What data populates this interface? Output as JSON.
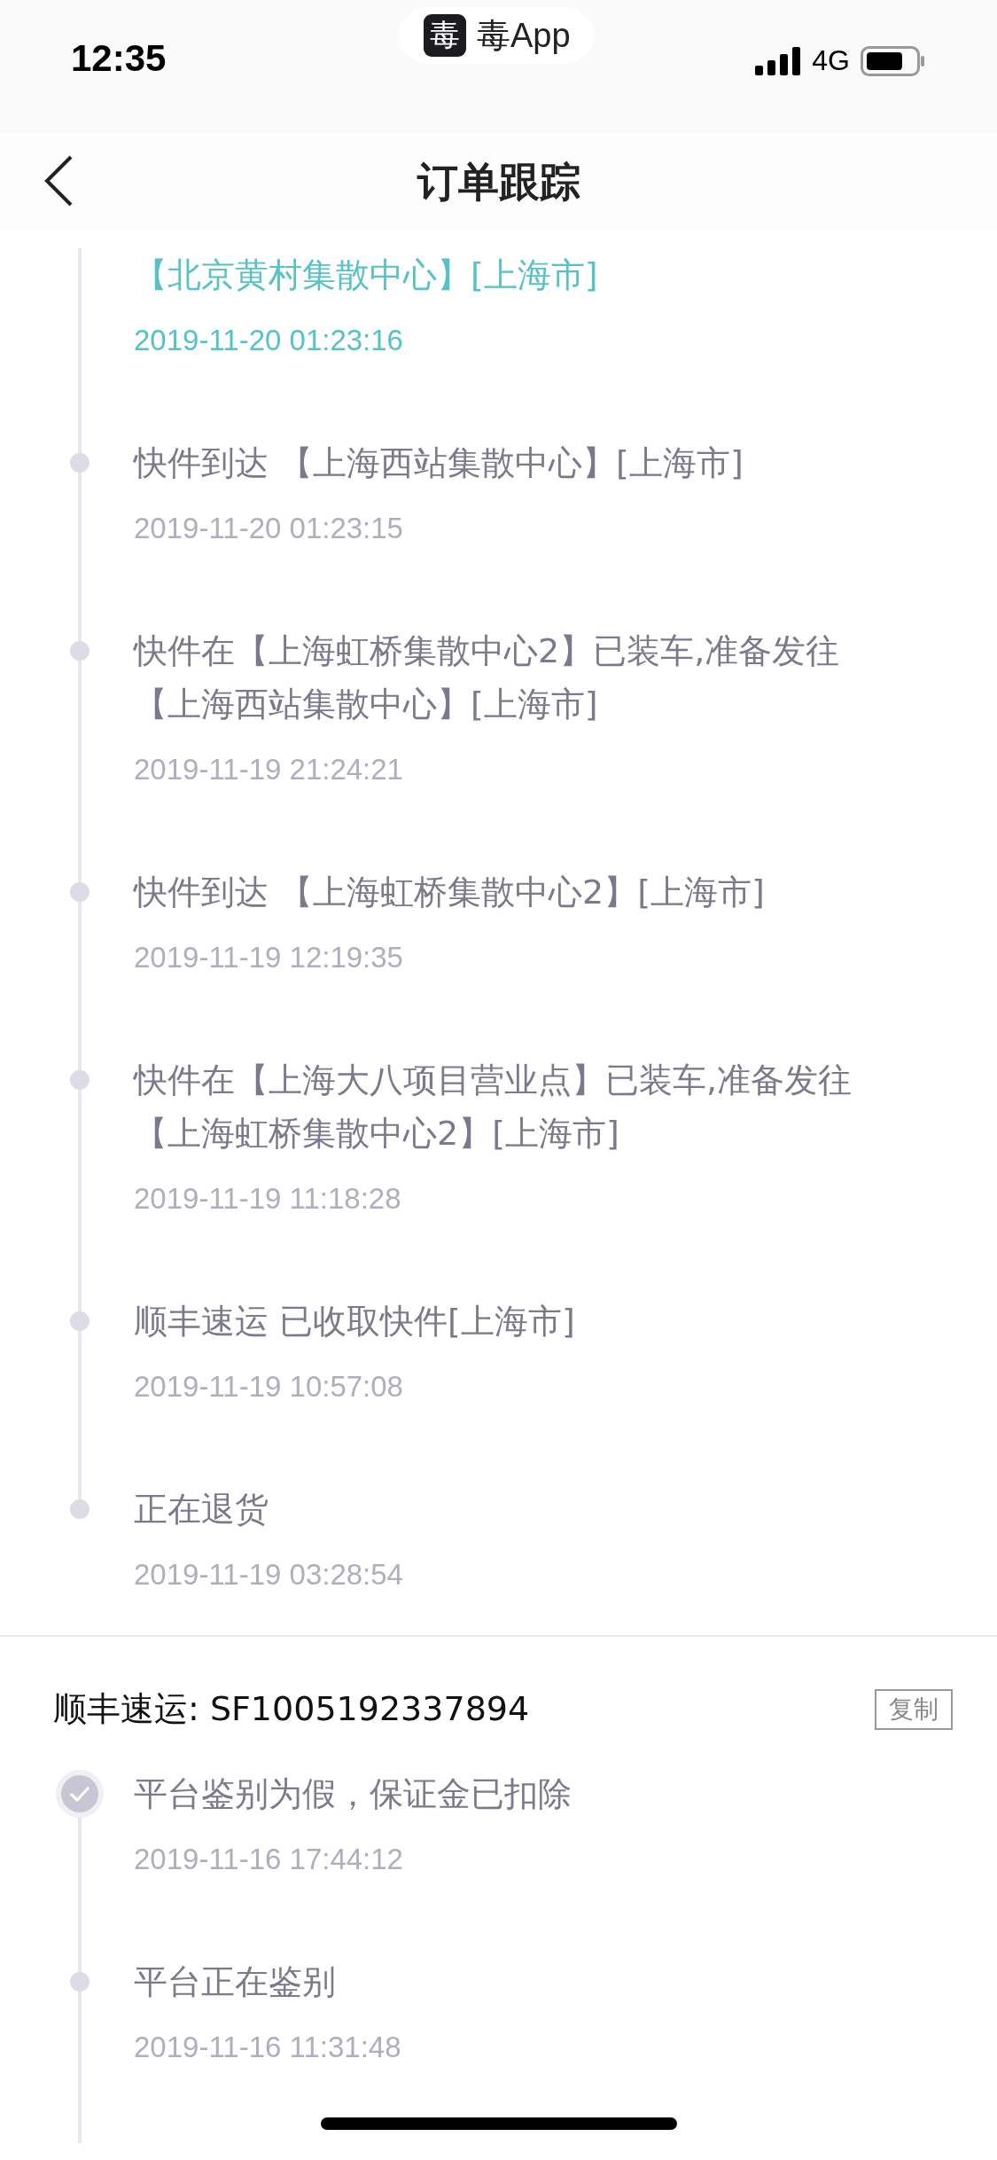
{
  "status_bar": {
    "time": "12:35",
    "app_badge": {
      "icon_char": "毒",
      "label": "毒App"
    },
    "network": "4G"
  },
  "nav": {
    "title": "订单跟踪"
  },
  "tracking": [
    {
      "lines": [
        "【北京黄村集散中心】[上海市]"
      ],
      "time": "2019-11-20 01:23:16",
      "current": true,
      "kind": "plain"
    },
    {
      "lines": [
        "快件到达 【上海西站集散中心】[上海市]"
      ],
      "time": "2019-11-20 01:23:15",
      "current": false,
      "kind": "dot"
    },
    {
      "lines": [
        "快件在【上海虹桥集散中心2】已装车,准备发往",
        "【上海西站集散中心】[上海市]"
      ],
      "time": "2019-11-19 21:24:21",
      "current": false,
      "kind": "dot"
    },
    {
      "lines": [
        "快件到达 【上海虹桥集散中心2】[上海市]"
      ],
      "time": "2019-11-19 12:19:35",
      "current": false,
      "kind": "dot"
    },
    {
      "lines": [
        "快件在【上海大八项目营业点】已装车,准备发往",
        "【上海虹桥集散中心2】[上海市]"
      ],
      "time": "2019-11-19 11:18:28",
      "current": false,
      "kind": "dot"
    },
    {
      "lines": [
        "顺丰速运 已收取快件[上海市]"
      ],
      "time": "2019-11-19 10:57:08",
      "current": false,
      "kind": "dot"
    },
    {
      "lines": [
        "正在退货"
      ],
      "time": "2019-11-19 03:28:54",
      "current": false,
      "kind": "dot"
    }
  ],
  "shipment": {
    "carrier_number": "顺丰速运: SF1005192337894",
    "copy_button": "复制",
    "events": [
      {
        "lines": [
          "平台鉴别为假，保证金已扣除"
        ],
        "time": "2019-11-16 17:44:12",
        "current": false,
        "kind": "check"
      },
      {
        "lines": [
          "平台正在鉴别"
        ],
        "time": "2019-11-16 11:31:48",
        "current": false,
        "kind": "dot"
      }
    ]
  }
}
